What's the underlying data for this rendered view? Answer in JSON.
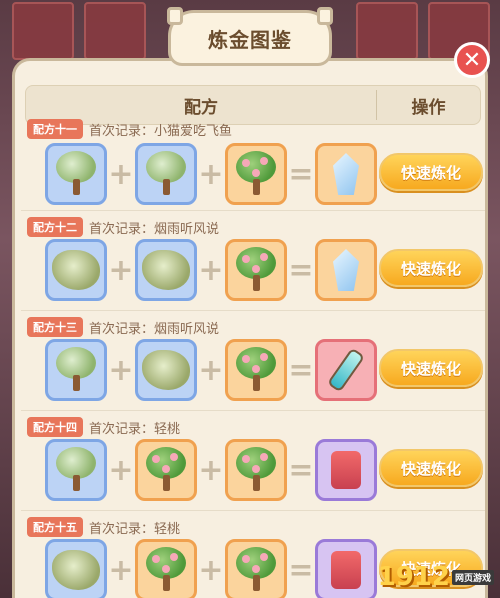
{
  "title": "炼金图鉴",
  "header": {
    "recipe_col": "配方",
    "action_col": "操作"
  },
  "rows": [
    {
      "tag": "配方十一",
      "record": "首次记录：小猫爱吃飞鱼",
      "button": "快速炼化",
      "inputs": [
        "blossom-tree",
        "blossom-tree",
        "pink-flower-tree"
      ],
      "result": "ice-crystal"
    },
    {
      "tag": "配方十二",
      "record": "首次记录：烟雨听风说",
      "button": "快速炼化",
      "inputs": [
        "mossy-shrub",
        "mossy-shrub",
        "pink-flower-tree"
      ],
      "result": "ice-crystal"
    },
    {
      "tag": "配方十三",
      "record": "首次记录：烟雨听风说",
      "button": "快速炼化",
      "inputs": [
        "blossom-tree",
        "mossy-shrub",
        "pink-flower-tree"
      ],
      "result": "potion-bottle"
    },
    {
      "tag": "配方十四",
      "record": "首次记录：轻桃",
      "button": "快速炼化",
      "inputs": [
        "blossom-tree",
        "pink-flower-tree",
        "pink-flower-tree"
      ],
      "result": "red-charm"
    },
    {
      "tag": "配方十五",
      "record": "首次记录：轻桃",
      "button": "快速炼化",
      "inputs": [
        "mossy-shrub",
        "pink-flower-tree",
        "pink-flower-tree"
      ],
      "result": "red-charm"
    }
  ],
  "watermark": {
    "text": "1912",
    "sub": "网页游戏"
  },
  "colors": {
    "button": "#f7a91f",
    "tag": "#e8765a",
    "close": "#e85250"
  }
}
